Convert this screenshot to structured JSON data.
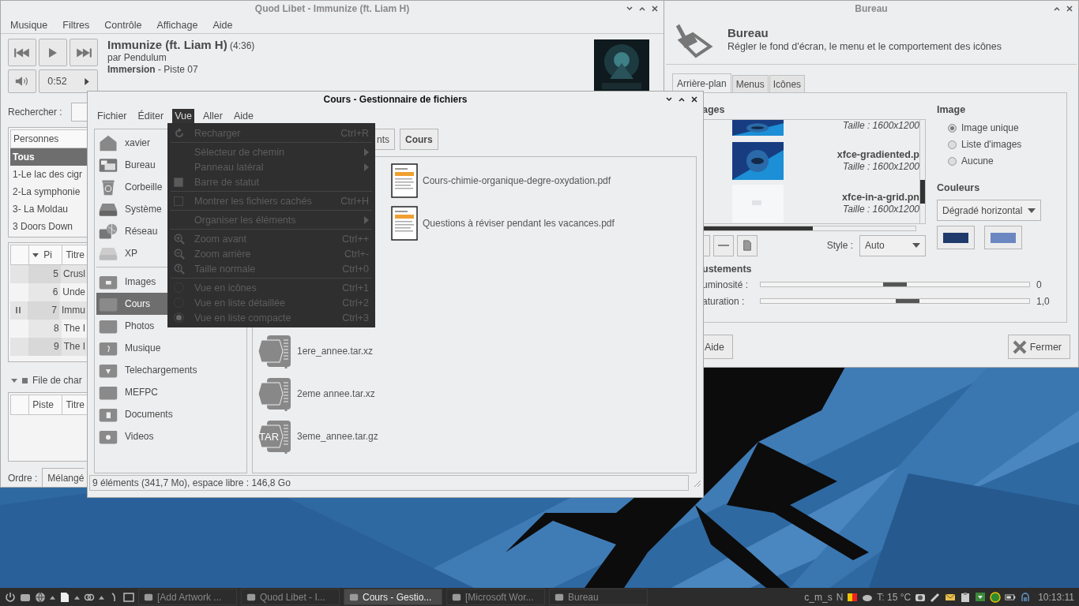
{
  "music_player": {
    "title": "Quod Libet - Immunize (ft. Liam H)",
    "menu": [
      "Musique",
      "Filtres",
      "Contrôle",
      "Affichage",
      "Aide"
    ],
    "track": {
      "title": "Immunize (ft. Liam H)",
      "duration": "(4:36)",
      "artist": "par Pendulum",
      "album": "Immersion",
      "number": "- Piste 07"
    },
    "position": "0:52",
    "search_label": "Rechercher :",
    "browser": {
      "header": "Personnes",
      "items": [
        {
          "label": "Tous",
          "selected": true
        },
        {
          "label": "1-Le lac des cigr",
          "selected": false
        },
        {
          "label": "2-La symphonie",
          "selected": false
        },
        {
          "label": "3- La Moldau",
          "selected": false
        },
        {
          "label": "3 Doors Down",
          "selected": false
        }
      ]
    },
    "songs": {
      "columns": [
        "Pi",
        "Titre"
      ],
      "rows": [
        {
          "number": "5",
          "title": "Crusl",
          "playing": false
        },
        {
          "number": "6",
          "title": "Unde",
          "playing": false
        },
        {
          "number": "7",
          "title": "Immu",
          "playing": true
        },
        {
          "number": "8",
          "title": "The I",
          "playing": false
        },
        {
          "number": "9",
          "title": "The I",
          "playing": false
        }
      ]
    },
    "queue": {
      "label": "File de char",
      "expanded": true,
      "columns": [
        "Piste",
        "Titre"
      ]
    },
    "order": {
      "label": "Ordre :",
      "value": "Mélangé"
    }
  },
  "file_manager": {
    "title": "Cours - Gestionnaire de fichiers",
    "menu": [
      {
        "label": "Fichier",
        "selected": false
      },
      {
        "label": "Éditer",
        "selected": false
      },
      {
        "label": "Vue",
        "selected": true
      },
      {
        "label": "Aller",
        "selected": false
      },
      {
        "label": "Aide",
        "selected": false
      }
    ],
    "devices": [
      {
        "label": "xavier",
        "kind": "home"
      },
      {
        "label": "Bureau",
        "kind": "desktop"
      },
      {
        "label": "Corbeille",
        "kind": "trash"
      },
      {
        "label": "Système",
        "kind": "drive"
      },
      {
        "label": "Réseau",
        "kind": "network"
      },
      {
        "label": "XP",
        "kind": "volume"
      }
    ],
    "bookmarks": [
      {
        "label": "Images",
        "kind": "pictures",
        "selected": false
      },
      {
        "label": "Cours",
        "kind": "folder",
        "selected": true
      },
      {
        "label": "Photos",
        "kind": "folder",
        "selected": false
      },
      {
        "label": "Musique",
        "kind": "music",
        "selected": false
      },
      {
        "label": "Telechargements",
        "kind": "download",
        "selected": false
      },
      {
        "label": "MEFPC",
        "kind": "folder",
        "selected": false
      },
      {
        "label": "Documents",
        "kind": "documents",
        "selected": false
      },
      {
        "label": "Videos",
        "kind": "videos",
        "selected": false
      }
    ],
    "path": [
      {
        "label": "nts",
        "selected": false
      },
      {
        "label": "Cours",
        "selected": true
      }
    ],
    "files_column_1": [
      {
        "name": "1ere_annee.tar.xz",
        "kind": "archive"
      },
      {
        "name": "2eme annee.tar.xz",
        "kind": "archive"
      },
      {
        "name": "3eme_annee.tar.gz",
        "kind": "archive",
        "badge": "TAR"
      }
    ],
    "files_column_2": [
      {
        "name": "Cours-chimie-organique-degre-oxydation.pdf",
        "kind": "pdf"
      },
      {
        "name": "Questions à réviser pendant les vacances.pdf",
        "kind": "pdf"
      }
    ],
    "status": "9 éléments (341,7 Mo), espace libre : 146,8 Go"
  },
  "view_menu": {
    "items": [
      {
        "kind": "reload",
        "label": "Recharger",
        "shortcut": "Ctrl+R",
        "disabled": true
      },
      {
        "kind": "separator"
      },
      {
        "kind": "submenu",
        "label": "Sélecteur de chemin",
        "disabled": true
      },
      {
        "kind": "submenu",
        "label": "Panneau latéral",
        "disabled": true
      },
      {
        "kind": "check",
        "label": "Barre de statut",
        "checked": true,
        "disabled": true
      },
      {
        "kind": "separator"
      },
      {
        "kind": "check",
        "label": "Montrer les fichiers cachés",
        "shortcut": "Ctrl+H",
        "checked": false,
        "disabled": true
      },
      {
        "kind": "separator"
      },
      {
        "kind": "submenu",
        "label": "Organiser les éléments",
        "disabled": true
      },
      {
        "kind": "separator"
      },
      {
        "kind": "zoomin",
        "label": "Zoom avant",
        "shortcut": "Ctrl++",
        "disabled": true
      },
      {
        "kind": "zoomout",
        "label": "Zoom arrière",
        "shortcut": "Ctrl+-",
        "disabled": true
      },
      {
        "kind": "zoomreset",
        "label": "Taille normale",
        "shortcut": "Ctrl+0",
        "disabled": true
      },
      {
        "kind": "separator"
      },
      {
        "kind": "radio",
        "label": "Vue en icônes",
        "shortcut": "Ctrl+1",
        "selected": false,
        "disabled": true
      },
      {
        "kind": "radio",
        "label": "Vue en liste détaillée",
        "shortcut": "Ctrl+2",
        "selected": false,
        "disabled": true
      },
      {
        "kind": "radio",
        "label": "Vue en liste compacte",
        "shortcut": "Ctrl+3",
        "selected": true,
        "disabled": true
      }
    ]
  },
  "desktop_settings": {
    "title": "Bureau",
    "heading": "Bureau",
    "description": "Régler le fond d'écran, le menu et le comportement des icônes",
    "tabs": [
      {
        "label": "Arrière-plan",
        "selected": true
      },
      {
        "label": "Menus",
        "selected": false
      },
      {
        "label": "Icônes",
        "selected": false
      }
    ],
    "images_heading": "ages",
    "wallpapers": [
      {
        "size": "Taille : 1600x1200"
      },
      {
        "name": "xfce-gradiented.p",
        "size": "Taille : 1600x1200"
      },
      {
        "name": "xfce-in-a-grid.pn",
        "size": "Taille : 1600x1200"
      }
    ],
    "style": {
      "label": "Style :",
      "value": "Auto"
    },
    "image_mode": {
      "heading": "Image",
      "options": [
        {
          "label": "Image unique",
          "selected": true
        },
        {
          "label": "Liste d'images",
          "selected": false
        },
        {
          "label": "Aucune",
          "selected": false
        }
      ]
    },
    "colors": {
      "heading": "Couleurs",
      "value": "Dégradé horizontal",
      "swatches": [
        {
          "color": "#1f3a6b"
        },
        {
          "color": "#6b87c1"
        }
      ]
    },
    "adjustments_heading": "ustements",
    "sliders": [
      {
        "label": "uminosité :",
        "level": 0.5,
        "reading": "0"
      },
      {
        "label": "aturation :",
        "level": 0.55,
        "reading": "1,0"
      }
    ],
    "buttons": [
      "Aide",
      "Fermer"
    ]
  },
  "taskbar": {
    "tasks": [
      {
        "label": "[Add  Artwork ...",
        "selected": false
      },
      {
        "label": "Quod Libet - I...",
        "selected": false
      },
      {
        "label": "Cours - Gestio...",
        "selected": true
      },
      {
        "label": "[Microsoft Wor...",
        "selected": false
      },
      {
        "label": "Bureau",
        "selected": false
      }
    ],
    "tray": [
      "c_m_s",
      "N",
      "T: 15 °C"
    ],
    "clock": "10:13:11"
  }
}
